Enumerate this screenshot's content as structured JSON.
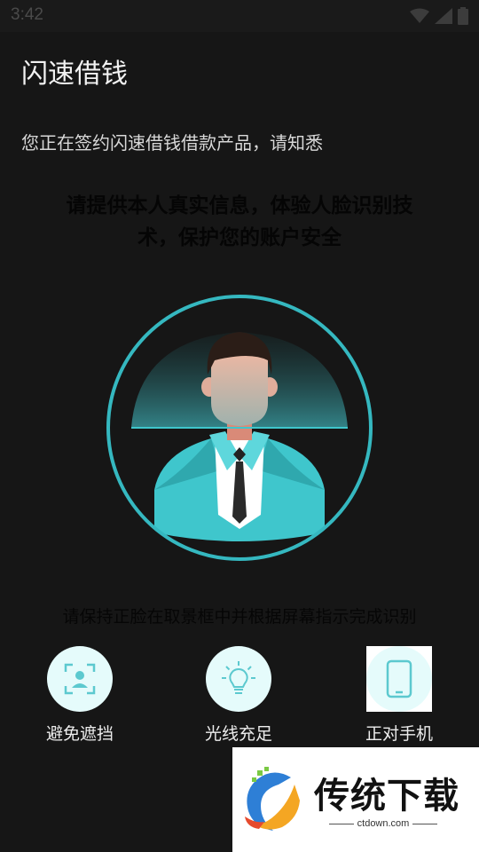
{
  "status_bar": {
    "time": "3:42"
  },
  "app": {
    "title": "闪速借钱"
  },
  "subtitle": "您正在签约闪速借钱借款产品，请知悉",
  "instruction": {
    "line1": "请提供本人真实信息，体验人脸识别技",
    "line2": "术，保护您的账户安全"
  },
  "hint": "请保持正脸在取景框中并根据屏幕指示完成识别",
  "tips": [
    {
      "label": "避免遮挡",
      "icon": "face-scan-icon"
    },
    {
      "label": "光线充足",
      "icon": "lightbulb-icon"
    },
    {
      "label": "正对手机",
      "icon": "phone-icon"
    }
  ],
  "watermark": {
    "brand": "传统下载",
    "url": "ctdown.com"
  },
  "colors": {
    "accent": "#35b8c0",
    "background": "#161616",
    "suit": "#3fc6cc"
  }
}
